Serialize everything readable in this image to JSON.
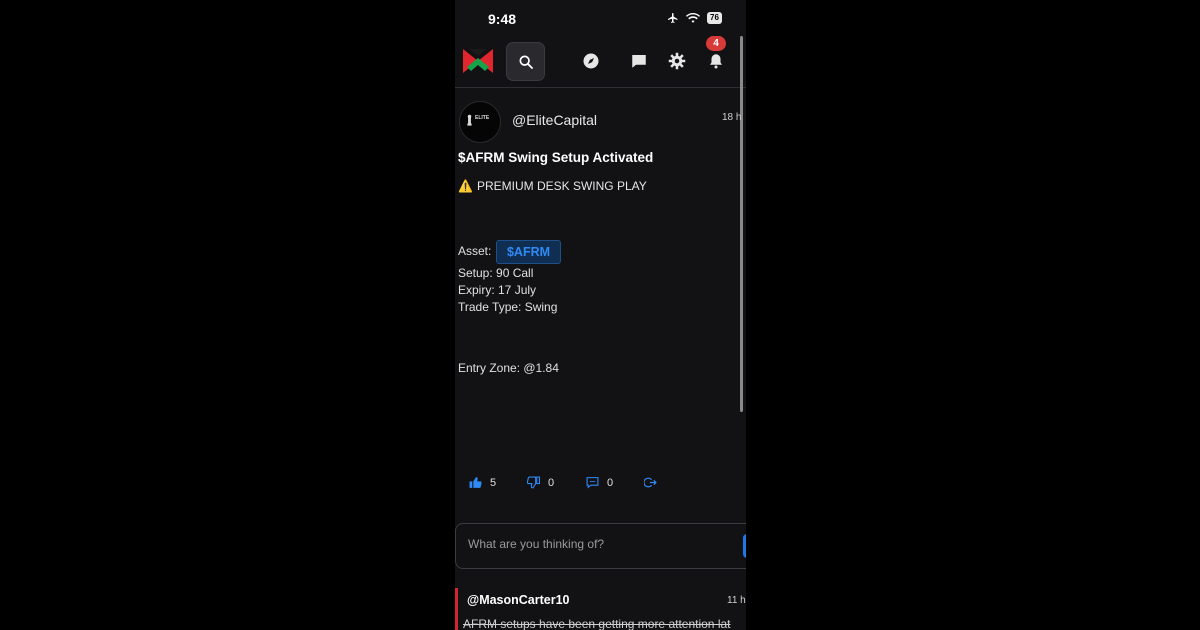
{
  "status_bar": {
    "time": "9:48",
    "battery": "76"
  },
  "nav": {
    "notification_count": "4"
  },
  "post": {
    "username": "@EliteCapital",
    "avatar_text": "ELITE",
    "time_ago": "18 h",
    "title": "$AFRM Swing Setup Activated",
    "subtitle": "PREMIUM DESK SWING PLAY",
    "warning_icon": "⚠️",
    "asset_label": "Asset:",
    "asset_ticker": "$AFRM",
    "setup": "Setup: 90 Call",
    "expiry": "Expiry: 17 July",
    "trade_type": "Trade Type: Swing",
    "entry_zone": "Entry Zone: @1.84",
    "likes": "5",
    "dislikes": "0",
    "comments": "0"
  },
  "composer": {
    "placeholder": "What are you thinking of?"
  },
  "comment": {
    "username": "@MasonCarter10",
    "time_ago": "11 h",
    "text": "AFRM setups have been getting more attention lat"
  },
  "colors": {
    "accent": "#2f8af5",
    "badge": "#d83a3a",
    "background": "#121214"
  }
}
